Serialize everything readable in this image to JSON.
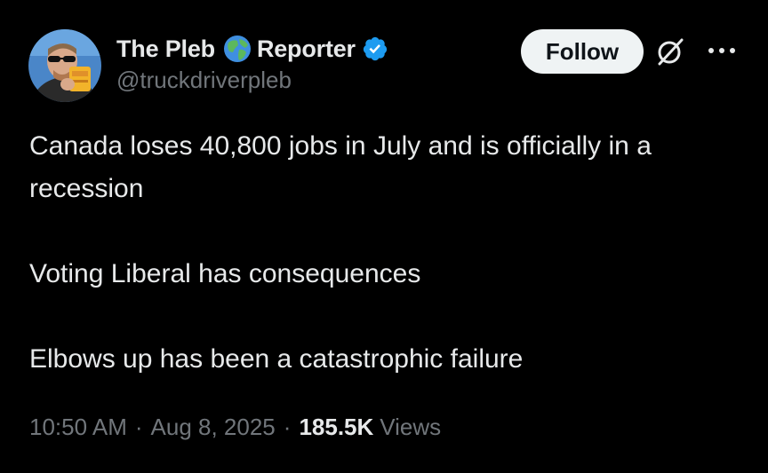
{
  "author": {
    "display_name_part1": "The Pleb",
    "display_name_part2": "Reporter",
    "handle": "@truckdriverpleb",
    "avatar_icon": "avatar-photo",
    "globe_icon": "globe-icon",
    "verified_icon": "verified-badge-icon",
    "verified_color": "#1d9bf0"
  },
  "actions": {
    "follow_label": "Follow",
    "grok_icon": "grok-icon",
    "more_icon": "more-icon"
  },
  "tweet": {
    "line1": "Canada loses 40,800 jobs in July and is officially in a recession",
    "line2": "Voting Liberal has consequences",
    "line3": "Elbows up has been a catastrophic failure"
  },
  "meta": {
    "time": "10:50 AM",
    "separator": "·",
    "date": "Aug 8, 2025",
    "views_count": "185.5K",
    "views_label": "Views"
  },
  "colors": {
    "background": "#000000",
    "primary_text": "#e7e9ea",
    "secondary_text": "#71767b",
    "follow_bg": "#eff3f4"
  }
}
